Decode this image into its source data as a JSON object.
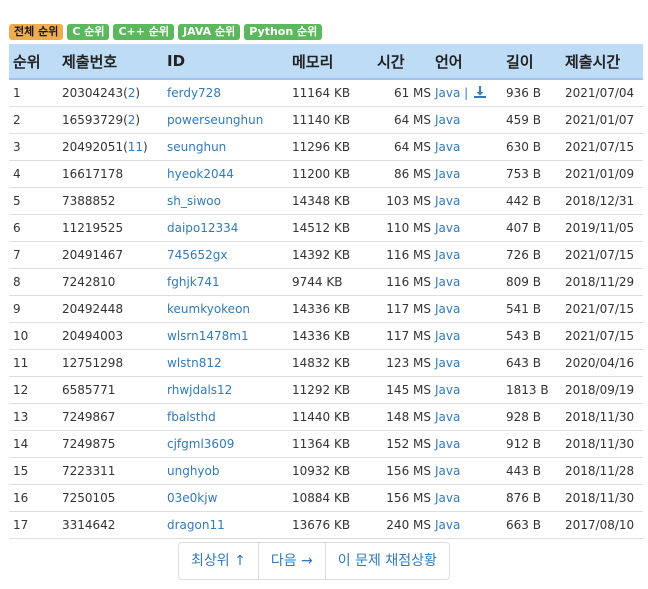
{
  "filters": [
    "전체 순위",
    "C 순위",
    "C++ 순위",
    "JAVA 순위",
    "Python 순위"
  ],
  "columns": [
    "순위",
    "제출번호",
    "ID",
    "메모리",
    "시간",
    "언어",
    "길이",
    "제출시간"
  ],
  "rows": [
    {
      "rank": "1",
      "submission": "20304243",
      "extra": "2",
      "id": "ferdy728",
      "memory": "11164 KB",
      "time": "61 MS",
      "lang": "Java",
      "length": "936 B",
      "date": "2021/07/04",
      "download": true
    },
    {
      "rank": "2",
      "submission": "16593729",
      "extra": "2",
      "id": "powerseunghun",
      "memory": "11140 KB",
      "time": "64 MS",
      "lang": "Java",
      "length": "459 B",
      "date": "2021/01/07"
    },
    {
      "rank": "3",
      "submission": "20492051",
      "extra": "11",
      "id": "seunghun",
      "memory": "11296 KB",
      "time": "64 MS",
      "lang": "Java",
      "length": "630 B",
      "date": "2021/07/15"
    },
    {
      "rank": "4",
      "submission": "16617178",
      "id": "hyeok2044",
      "memory": "11200 KB",
      "time": "86 MS",
      "lang": "Java",
      "length": "753 B",
      "date": "2021/01/09"
    },
    {
      "rank": "5",
      "submission": "7388852",
      "id": "sh_siwoo",
      "memory": "14348 KB",
      "time": "103 MS",
      "lang": "Java",
      "length": "442 B",
      "date": "2018/12/31"
    },
    {
      "rank": "6",
      "submission": "11219525",
      "id": "daipo12334",
      "memory": "14512 KB",
      "time": "110 MS",
      "lang": "Java",
      "length": "407 B",
      "date": "2019/11/05"
    },
    {
      "rank": "7",
      "submission": "20491467",
      "id": "745652gx",
      "memory": "14392 KB",
      "time": "116 MS",
      "lang": "Java",
      "length": "726 B",
      "date": "2021/07/15"
    },
    {
      "rank": "8",
      "submission": "7242810",
      "id": "fghjk741",
      "memory": "9744 KB",
      "time": "116 MS",
      "lang": "Java",
      "length": "809 B",
      "date": "2018/11/29"
    },
    {
      "rank": "9",
      "submission": "20492448",
      "id": "keumkyokeon",
      "memory": "14336 KB",
      "time": "117 MS",
      "lang": "Java",
      "length": "541 B",
      "date": "2021/07/15"
    },
    {
      "rank": "10",
      "submission": "20494003",
      "id": "wlsrn1478m1",
      "memory": "14336 KB",
      "time": "117 MS",
      "lang": "Java",
      "length": "543 B",
      "date": "2021/07/15"
    },
    {
      "rank": "11",
      "submission": "12751298",
      "id": "wlstn812",
      "memory": "14832 KB",
      "time": "123 MS",
      "lang": "Java",
      "length": "643 B",
      "date": "2020/04/16"
    },
    {
      "rank": "12",
      "submission": "6585771",
      "id": "rhwjdals12",
      "memory": "11292 KB",
      "time": "145 MS",
      "lang": "Java",
      "length": "1813 B",
      "date": "2018/09/19"
    },
    {
      "rank": "13",
      "submission": "7249867",
      "id": "fbalsthd",
      "memory": "11440 KB",
      "time": "148 MS",
      "lang": "Java",
      "length": "928 B",
      "date": "2018/11/30"
    },
    {
      "rank": "14",
      "submission": "7249875",
      "id": "cjfgml3609",
      "memory": "11364 KB",
      "time": "152 MS",
      "lang": "Java",
      "length": "912 B",
      "date": "2018/11/30"
    },
    {
      "rank": "15",
      "submission": "7223311",
      "id": "unghyob",
      "memory": "10932 KB",
      "time": "156 MS",
      "lang": "Java",
      "length": "443 B",
      "date": "2018/11/28"
    },
    {
      "rank": "16",
      "submission": "7250105",
      "id": "03e0kjw",
      "memory": "10884 KB",
      "time": "156 MS",
      "lang": "Java",
      "length": "876 B",
      "date": "2018/11/30"
    },
    {
      "rank": "17",
      "submission": "3314642",
      "id": "dragon11",
      "memory": "13676 KB",
      "time": "240 MS",
      "lang": "Java",
      "length": "663 B",
      "date": "2017/08/10"
    }
  ],
  "pager": {
    "top": "최상위 ↑",
    "next": "다음 →",
    "status": "이 문제 채점상황"
  },
  "colors": {
    "header_bg": "#bfdcf7",
    "link": "#337ab7",
    "badge_yellow": "#f0ad4e",
    "badge_green": "#5cb85c"
  },
  "icons": {
    "download": "download-icon"
  }
}
